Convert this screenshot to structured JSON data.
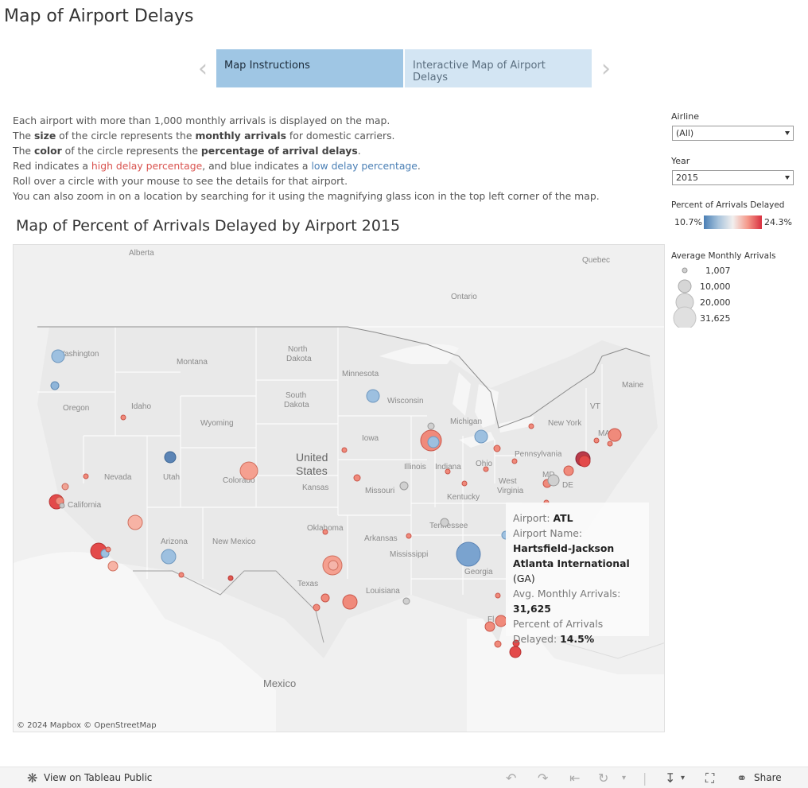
{
  "page_title": "Map of Airport Delays",
  "tabs": [
    {
      "label": "Map Instructions",
      "active": true
    },
    {
      "label": "Interactive Map of Airport Delays",
      "active": false
    }
  ],
  "instructions": {
    "line1": "Each airport with more than 1,000 monthly arrivals is displayed on the map.",
    "line2_a": "The ",
    "line2_b": "size",
    "line2_c": " of the circle represents the ",
    "line2_d": "monthly arrivals",
    "line2_e": " for domestic carriers.",
    "line3_a": "The ",
    "line3_b": "color",
    "line3_c": " of the circle represents the ",
    "line3_d": "percentage of arrival delays",
    "line3_e": ".",
    "line4_a": "Red indicates a ",
    "line4_b": "high delay percentage",
    "line4_c": ", and blue indicates a ",
    "line4_d": "low delay percentage",
    "line4_e": ".",
    "line5": "Roll over a circle with your mouse to see the details for that airport.",
    "line6": "You can also zoom in on a location by searching for it using the magnifying glass icon in the top left corner of the map."
  },
  "map": {
    "title": "Map of Percent of Arrivals Delayed by Airport 2015",
    "attribution": "© 2024 Mapbox  © OpenStreetMap",
    "labels": {
      "alberta": "Alberta",
      "quebec": "Quebec",
      "ontario": "Ontario",
      "washington": "Washington",
      "montana": "Montana",
      "north_dakota_1": "North",
      "north_dakota_2": "Dakota",
      "minnesota": "Minnesota",
      "maine": "Maine",
      "oregon": "Oregon",
      "idaho": "Idaho",
      "south_dakota_1": "South",
      "south_dakota_2": "Dakota",
      "wisconsin": "Wisconsin",
      "michigan": "Michigan",
      "vermont": "VT",
      "new_york": "New York",
      "wyoming": "Wyoming",
      "iowa": "Iowa",
      "massachusetts": "MA",
      "pennsylvania": "Pennsylvania",
      "nevada": "Nevada",
      "utah": "Utah",
      "colorado": "Colorado",
      "united_states_1": "United",
      "united_states_2": "States",
      "illinois": "Illinois",
      "indiana": "Indiana",
      "ohio": "Ohio",
      "california": "California",
      "kansas": "Kansas",
      "missouri": "Missouri",
      "west_virginia_1": "West",
      "west_virginia_2": "Virginia",
      "maryland": "MD",
      "delaware": "DE",
      "kentucky": "Kentucky",
      "oklahoma": "Oklahoma",
      "tennessee": "Tennessee",
      "arizona": "Arizona",
      "new_mexico": "New Mexico",
      "arkansas": "Arkansas",
      "mississippi": "Mississippi",
      "georgia": "Georgia",
      "texas": "Texas",
      "louisiana": "Louisiana",
      "florida": "Fl",
      "mexico": "Mexico"
    }
  },
  "tooltip": {
    "airport_label": "Airport:",
    "airport_value": "ATL",
    "name_label": "Airport Name:",
    "name_value_1": "Hartsfield-Jackson",
    "name_value_2": "Atlanta International",
    "name_state": "(GA)",
    "arrivals_label": "Avg. Monthly Arrivals:",
    "arrivals_value": "31,625",
    "delay_label_1": "Percent of Arrivals",
    "delay_label_2": "Delayed:",
    "delay_value": "14.5%"
  },
  "filters": {
    "airline": {
      "label": "Airline",
      "value": "(All)"
    },
    "year": {
      "label": "Year",
      "value": "2015"
    }
  },
  "color_legend": {
    "title": "Percent of Arrivals Delayed",
    "min": "10.7%",
    "max": "24.3%",
    "colors": [
      "#4a7fb5",
      "#a7c3dc",
      "#f2efee",
      "#f59b8c",
      "#d9303f"
    ]
  },
  "size_legend": {
    "title": "Average Monthly Arrivals",
    "items": [
      "1,007",
      "10,000",
      "20,000",
      "31,625"
    ]
  },
  "bottom_bar": {
    "view_label": "View on Tableau Public",
    "share_label": "Share"
  }
}
